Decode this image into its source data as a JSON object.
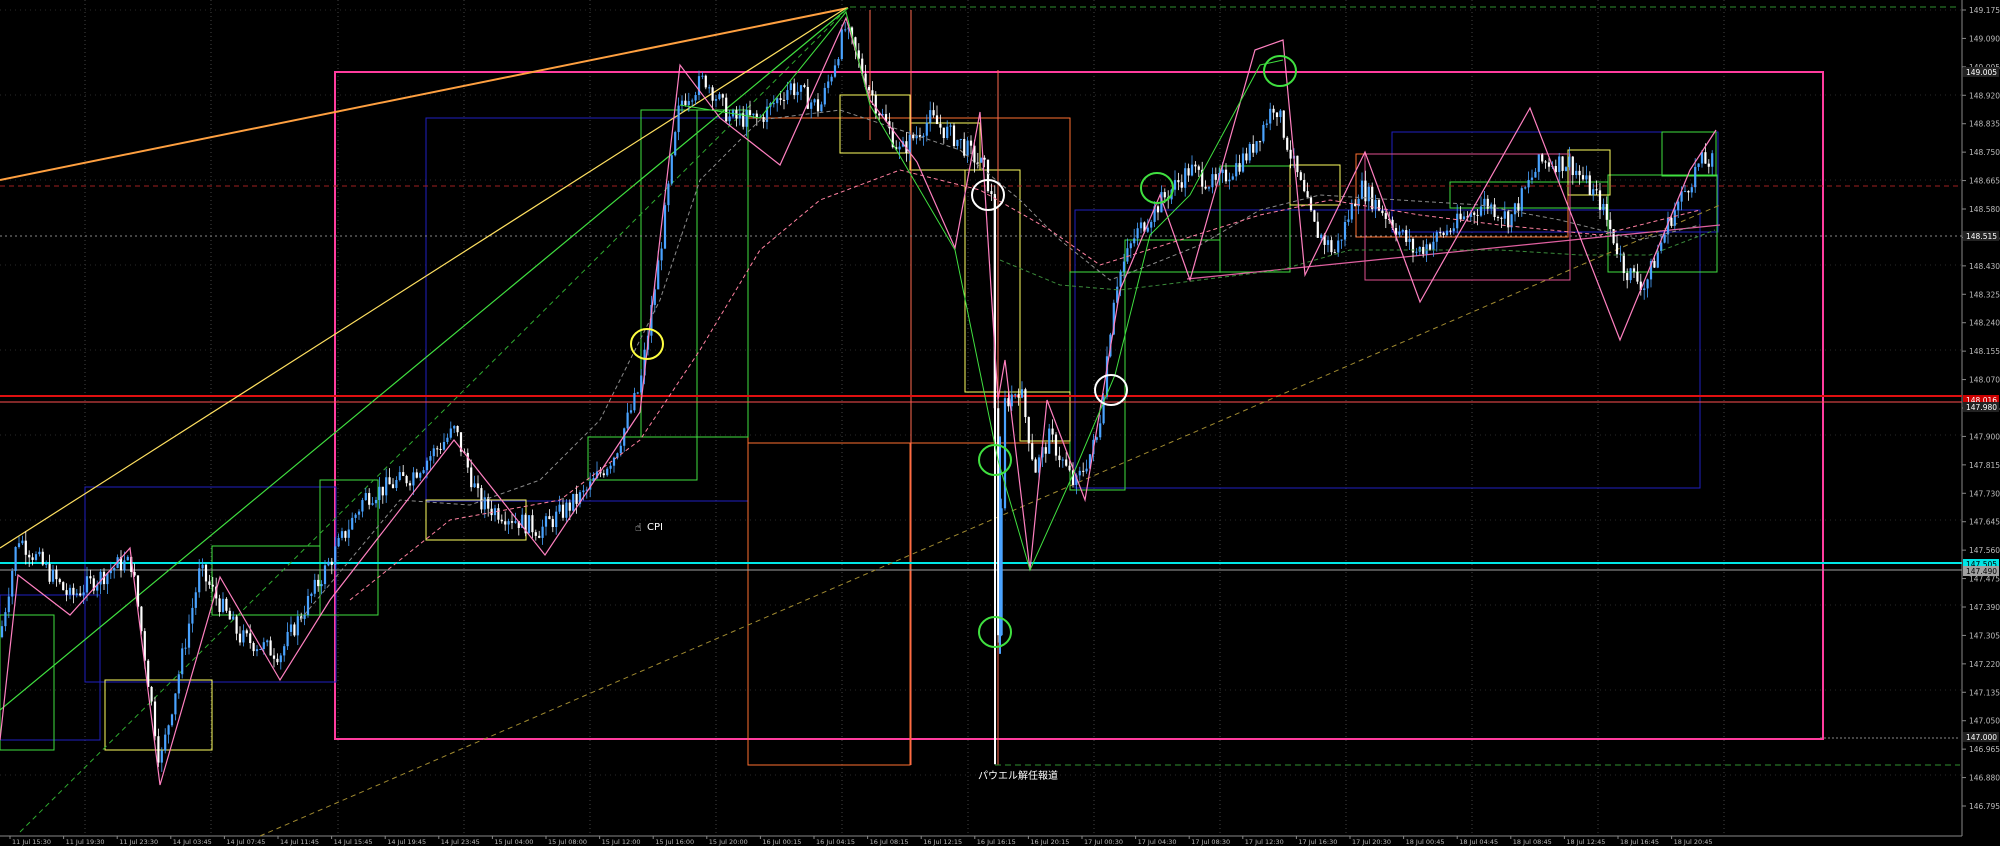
{
  "annotations": {
    "cpi_label": "CPI",
    "powell_label": "パウエル解任報道"
  },
  "price_scale": {
    "labels": [
      "149.175",
      "149.090",
      "149.005",
      "148.920",
      "148.835",
      "148.750",
      "148.665",
      "148.580",
      "148.495",
      "148.430",
      "148.325",
      "148.240",
      "148.155",
      "148.070",
      "147.985",
      "147.900",
      "147.815",
      "147.730",
      "147.645",
      "147.560",
      "147.475",
      "147.390",
      "147.305",
      "147.220",
      "147.135",
      "147.050",
      "146.965",
      "146.880",
      "146.795"
    ],
    "tags": [
      {
        "text": "149.005",
        "color": "#ffffff",
        "bg": "#222222"
      },
      {
        "text": "148.515",
        "color": "#ffffff",
        "bg": "#222222"
      },
      {
        "text": "148.016",
        "color": "#ffffff",
        "bg": "#cc0000"
      },
      {
        "text": "147.980",
        "color": "#ffffff",
        "bg": "#222222"
      },
      {
        "text": "147.505",
        "color": "#000000",
        "bg": "#00e5e5"
      },
      {
        "text": "147.490",
        "color": "#000000",
        "bg": "#a0a0a0"
      },
      {
        "text": "147.000",
        "color": "#ffffff",
        "bg": "#222222"
      }
    ]
  },
  "time_axis": {
    "labels": [
      "11 Jul 15:30",
      "11 Jul 19:30",
      "11 Jul 23:30",
      "14 Jul 03:45",
      "14 Jul 07:45",
      "14 Jul 11:45",
      "14 Jul 15:45",
      "14 Jul 19:45",
      "14 Jul 23:45",
      "15 Jul 04:00",
      "15 Jul 08:00",
      "15 Jul 12:00",
      "15 Jul 16:00",
      "15 Jul 20:00",
      "16 Jul 00:15",
      "16 Jul 04:15",
      "16 Jul 08:15",
      "16 Jul 12:15",
      "16 Jul 16:15",
      "16 Jul 20:15",
      "17 Jul 00:30",
      "17 Jul 04:30",
      "17 Jul 08:30",
      "17 Jul 12:30",
      "17 Jul 16:30",
      "17 Jul 20:30",
      "18 Jul 00:45",
      "18 Jul 04:45",
      "18 Jul 08:45",
      "18 Jul 12:45",
      "18 Jul 16:45",
      "18 Jul 20:45"
    ]
  },
  "colors": {
    "background": "#000000",
    "candle_up": "#4aa3ff",
    "candle_down": "#ffffff",
    "magenta": "#ff3c9e",
    "cyan": "#00e5e5",
    "red": "#e01010",
    "orange": "#ffa040",
    "yellow": "#ffff60",
    "green": "#40e040",
    "pink": "#ff88cc",
    "blue_box": "#2020c0"
  }
}
